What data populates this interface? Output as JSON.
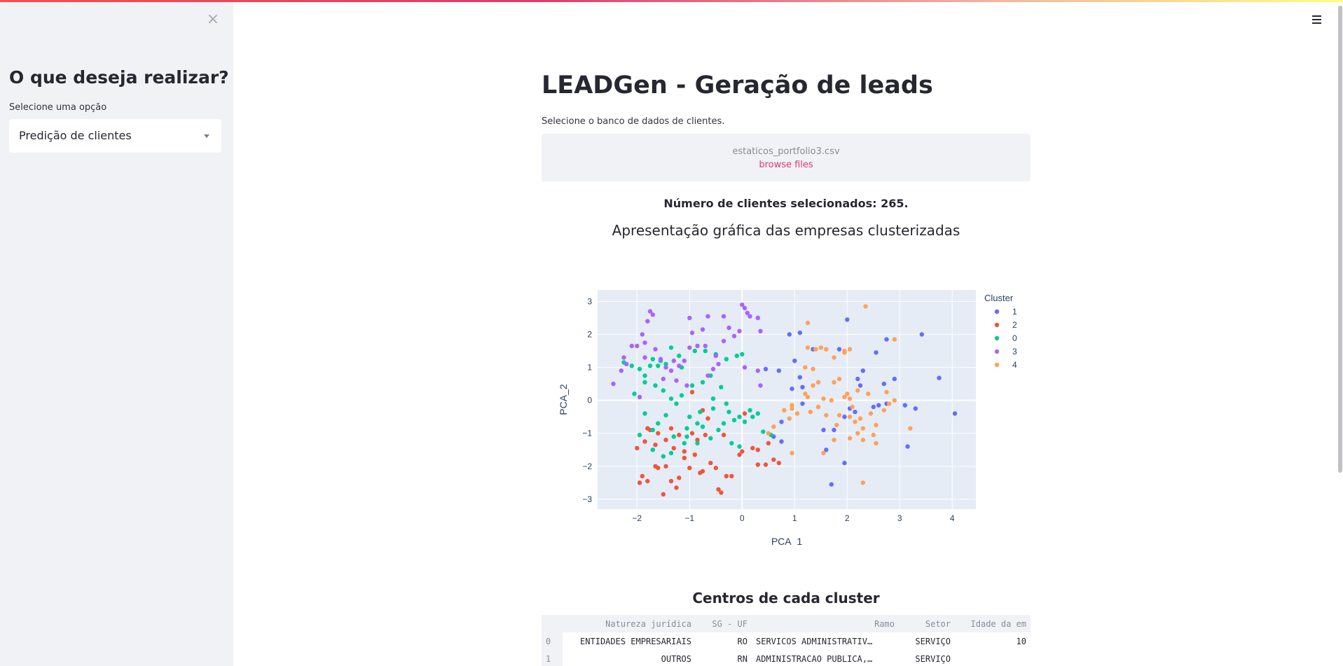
{
  "sidebar": {
    "heading": "O que deseja realizar?",
    "select_label": "Selecione uma opção",
    "selected_option": "Predição de clientes",
    "close_symbol": "×"
  },
  "main": {
    "title": "LEADGen - Geração de leads",
    "upload_label": "Selecione o banco de dados de clientes.",
    "uploaded_file": "estaticos_portfolio3.csv",
    "browse_label": "browse files",
    "count_text": "Número de clientes selecionados: 265.",
    "chart_heading": "Apresentação gráfica das empresas clusterizadas",
    "table_heading": "Centros de cada cluster"
  },
  "table": {
    "columns": [
      "",
      "Natureza jurídica",
      "SG - UF",
      "Ramo",
      "Setor",
      "Idade da em"
    ],
    "rows": [
      [
        "0",
        "ENTIDADES EMPRESARIAIS",
        "RO",
        "SERVICOS ADMINISTRATIV…",
        "SERVIÇO",
        "10"
      ],
      [
        "1",
        "OUTROS",
        "RN",
        "ADMINISTRACAO PUBLICA,…",
        "SERVIÇO",
        ""
      ]
    ]
  },
  "icons": {
    "close": "close-icon",
    "menu": "hamburger-menu-icon",
    "dropdown": "chevron-down-icon"
  },
  "chart_data": {
    "type": "scatter",
    "title": "",
    "xlabel": "PCA_1",
    "ylabel": "PCA_2",
    "xlim": [
      -2.75,
      4.45
    ],
    "ylim": [
      -3.3,
      3.35
    ],
    "xticks": [
      -2,
      -1,
      0,
      1,
      2,
      3,
      4
    ],
    "yticks": [
      -3,
      -2,
      -1,
      0,
      1,
      2,
      3
    ],
    "xtick_labels": [
      "−2",
      "−1",
      "0",
      "1",
      "2",
      "3",
      "4"
    ],
    "ytick_labels": [
      "−3",
      "−2",
      "−1",
      "0",
      "1",
      "2",
      "3"
    ],
    "legend_title": "Cluster",
    "legend_position": "right",
    "grid": true,
    "plot_bg": "#e5ecf6",
    "series": [
      {
        "name": "1",
        "color": "#636efa",
        "points": [
          [
            3.42,
            2.0
          ],
          [
            3.75,
            0.68
          ],
          [
            4.05,
            -0.4
          ],
          [
            2.0,
            2.45
          ],
          [
            1.1,
            2.05
          ],
          [
            1.35,
            1.55
          ],
          [
            2.55,
            1.45
          ],
          [
            2.75,
            1.85
          ],
          [
            0.9,
            2.0
          ],
          [
            0.7,
            0.9
          ],
          [
            1.1,
            0.7
          ],
          [
            1.15,
            0.4
          ],
          [
            0.95,
            0.35
          ],
          [
            2.2,
            0.65
          ],
          [
            2.25,
            0.45
          ],
          [
            2.9,
            0.65
          ],
          [
            2.7,
            0.5
          ],
          [
            2.5,
            -0.2
          ],
          [
            2.6,
            -0.15
          ],
          [
            2.75,
            -0.1
          ],
          [
            3.1,
            -0.15
          ],
          [
            3.3,
            -0.25
          ],
          [
            2.05,
            -0.25
          ],
          [
            2.15,
            -0.35
          ],
          [
            1.95,
            -0.5
          ],
          [
            1.75,
            -0.9
          ],
          [
            1.55,
            -0.9
          ],
          [
            0.75,
            -0.65
          ],
          [
            0.6,
            -1.1
          ],
          [
            0.75,
            -1.25
          ],
          [
            1.6,
            -1.5
          ],
          [
            3.15,
            -1.4
          ],
          [
            1.95,
            -1.9
          ],
          [
            1.7,
            -2.55
          ],
          [
            1.15,
            -0.1
          ],
          [
            0.45,
            0.95
          ],
          [
            1.0,
            1.2
          ],
          [
            1.85,
            1.55
          ],
          [
            2.3,
            0.9
          ]
        ]
      },
      {
        "name": "2",
        "color": "#ef553b",
        "points": [
          [
            -2.0,
            -1.45
          ],
          [
            -1.85,
            -1.25
          ],
          [
            -1.8,
            -0.85
          ],
          [
            -1.75,
            -0.9
          ],
          [
            -1.6,
            -1.0
          ],
          [
            -1.45,
            -1.2
          ],
          [
            -1.35,
            -0.85
          ],
          [
            -1.2,
            -1.05
          ],
          [
            -1.3,
            -1.45
          ],
          [
            -1.1,
            -1.55
          ],
          [
            -0.95,
            -1.0
          ],
          [
            -0.85,
            -1.2
          ],
          [
            -0.7,
            -1.05
          ],
          [
            -0.75,
            -0.3
          ],
          [
            -0.95,
            0.25
          ],
          [
            -0.65,
            -0.55
          ],
          [
            -1.9,
            -2.3
          ],
          [
            -1.95,
            -2.5
          ],
          [
            -1.8,
            -2.45
          ],
          [
            -1.65,
            -2.0
          ],
          [
            -1.6,
            -2.05
          ],
          [
            -1.5,
            -2.85
          ],
          [
            -1.45,
            -2.0
          ],
          [
            -1.35,
            -2.45
          ],
          [
            -1.25,
            -2.65
          ],
          [
            -1.2,
            -2.35
          ],
          [
            -1.0,
            -2.05
          ],
          [
            -0.8,
            -2.2
          ],
          [
            -0.75,
            -2.15
          ],
          [
            -0.6,
            -1.9
          ],
          [
            -0.5,
            -2.05
          ],
          [
            -0.45,
            -2.7
          ],
          [
            -0.4,
            -2.8
          ],
          [
            -0.3,
            -2.3
          ],
          [
            -0.2,
            -2.3
          ],
          [
            -0.05,
            -1.65
          ],
          [
            0.0,
            -1.55
          ],
          [
            -0.35,
            -1.05
          ],
          [
            0.05,
            -0.4
          ],
          [
            0.3,
            -1.5
          ],
          [
            0.2,
            -1.45
          ],
          [
            0.6,
            -1.8
          ],
          [
            0.5,
            -1.3
          ],
          [
            0.3,
            -1.95
          ],
          [
            0.45,
            -1.95
          ],
          [
            0.7,
            -1.9
          ],
          [
            -1.1,
            -1.75
          ],
          [
            -0.9,
            -1.65
          ],
          [
            -1.65,
            -1.35
          ]
        ]
      },
      {
        "name": "0",
        "color": "#00cc96",
        "points": [
          [
            -2.25,
            1.15
          ],
          [
            -2.1,
            1.05
          ],
          [
            -1.95,
            0.95
          ],
          [
            -1.85,
            0.75
          ],
          [
            -1.75,
            1.05
          ],
          [
            -1.7,
            1.25
          ],
          [
            -1.6,
            1.05
          ],
          [
            -1.55,
            1.2
          ],
          [
            -1.45,
            1.1
          ],
          [
            -1.35,
            1.6
          ],
          [
            -1.2,
            1.35
          ],
          [
            -1.15,
            1.0
          ],
          [
            -0.9,
            1.5
          ],
          [
            -0.7,
            1.5
          ],
          [
            -0.5,
            1.4
          ],
          [
            -0.3,
            1.25
          ],
          [
            -0.1,
            1.35
          ],
          [
            0.0,
            1.4
          ],
          [
            -1.85,
            0.55
          ],
          [
            -1.65,
            0.45
          ],
          [
            -1.5,
            0.3
          ],
          [
            -1.35,
            0.05
          ],
          [
            -1.25,
            -0.1
          ],
          [
            -1.15,
            0.15
          ],
          [
            -1.45,
            -0.45
          ],
          [
            -1.6,
            -0.7
          ],
          [
            -1.7,
            -0.9
          ],
          [
            -1.3,
            -1.1
          ],
          [
            -1.1,
            -1.3
          ],
          [
            -1.0,
            -0.5
          ],
          [
            -0.85,
            -0.7
          ],
          [
            -0.75,
            -0.8
          ],
          [
            -0.55,
            -0.25
          ],
          [
            -0.45,
            -0.9
          ],
          [
            -0.35,
            -0.7
          ],
          [
            -0.25,
            -0.35
          ],
          [
            -0.15,
            -0.6
          ],
          [
            -0.05,
            -0.5
          ],
          [
            0.05,
            -0.65
          ],
          [
            0.15,
            -0.3
          ],
          [
            0.3,
            -0.4
          ],
          [
            -0.2,
            -1.3
          ],
          [
            -0.05,
            -1.4
          ],
          [
            -0.6,
            -1.15
          ],
          [
            -0.85,
            -1.3
          ],
          [
            -1.05,
            -1.1
          ],
          [
            -1.35,
            -1.6
          ],
          [
            -1.5,
            -1.7
          ],
          [
            -1.7,
            -1.5
          ],
          [
            -1.95,
            -1.05
          ],
          [
            -2.05,
            0.2
          ],
          [
            -1.85,
            -0.4
          ],
          [
            -0.95,
            0.45
          ],
          [
            -0.75,
            0.55
          ],
          [
            -0.6,
            0.75
          ],
          [
            -0.4,
            0.4
          ],
          [
            -0.55,
            0.05
          ],
          [
            -0.3,
            -0.1
          ],
          [
            0.2,
            -0.5
          ],
          [
            0.4,
            -0.95
          ],
          [
            0.55,
            -1.05
          ],
          [
            -1.05,
            -0.85
          ],
          [
            -0.8,
            -0.35
          ]
        ]
      },
      {
        "name": "3",
        "color": "#ab63fa",
        "points": [
          [
            -2.45,
            0.5
          ],
          [
            -2.3,
            0.9
          ],
          [
            -2.2,
            1.1
          ],
          [
            -2.1,
            1.65
          ],
          [
            -2.0,
            1.65
          ],
          [
            -1.9,
            2.0
          ],
          [
            -1.85,
            1.75
          ],
          [
            -1.95,
            0.1
          ],
          [
            -1.8,
            2.4
          ],
          [
            -1.75,
            2.7
          ],
          [
            -1.7,
            2.6
          ],
          [
            -1.65,
            1.55
          ],
          [
            -1.55,
            1.25
          ],
          [
            -1.45,
            1.0
          ],
          [
            -1.35,
            0.9
          ],
          [
            -1.3,
            1.2
          ],
          [
            -1.2,
            1.05
          ],
          [
            -1.1,
            1.2
          ],
          [
            -1.0,
            1.6
          ],
          [
            -0.95,
            2.05
          ],
          [
            -0.85,
            1.65
          ],
          [
            -0.75,
            2.15
          ],
          [
            -0.7,
            1.65
          ],
          [
            -0.65,
            2.55
          ],
          [
            -0.5,
            1.35
          ],
          [
            -0.45,
            1.1
          ],
          [
            -0.35,
            2.55
          ],
          [
            -0.25,
            2.2
          ],
          [
            -0.15,
            1.95
          ],
          [
            -0.05,
            2.1
          ],
          [
            0.0,
            2.9
          ],
          [
            0.05,
            2.8
          ],
          [
            0.1,
            2.65
          ],
          [
            0.15,
            2.55
          ],
          [
            0.3,
            2.5
          ],
          [
            0.35,
            2.1
          ],
          [
            0.35,
            0.45
          ],
          [
            -0.55,
            0.95
          ],
          [
            -0.65,
            0.75
          ],
          [
            -1.05,
            0.45
          ],
          [
            -1.5,
            0.65
          ],
          [
            -1.25,
            0.6
          ],
          [
            -1.85,
            1.3
          ],
          [
            -2.25,
            1.3
          ],
          [
            -0.35,
            1.8
          ],
          [
            -1.0,
            2.5
          ],
          [
            0.05,
            1.0
          ],
          [
            0.3,
            0.9
          ]
        ]
      },
      {
        "name": "4",
        "color": "#ffa15a",
        "points": [
          [
            2.35,
            2.85
          ],
          [
            2.9,
            1.85
          ],
          [
            1.25,
            2.35
          ],
          [
            1.25,
            1.6
          ],
          [
            1.4,
            1.55
          ],
          [
            1.5,
            1.6
          ],
          [
            1.6,
            1.55
          ],
          [
            1.75,
            1.3
          ],
          [
            1.95,
            1.5
          ],
          [
            2.05,
            1.55
          ],
          [
            1.95,
            1.45
          ],
          [
            1.2,
            1.0
          ],
          [
            1.35,
            0.95
          ],
          [
            1.45,
            0.55
          ],
          [
            1.75,
            0.55
          ],
          [
            1.85,
            0.65
          ],
          [
            1.55,
            0.05
          ],
          [
            1.7,
            0.0
          ],
          [
            1.45,
            -0.2
          ],
          [
            1.3,
            -0.35
          ],
          [
            1.05,
            -0.4
          ],
          [
            0.95,
            -0.25
          ],
          [
            0.8,
            -0.3
          ],
          [
            0.95,
            -0.15
          ],
          [
            1.2,
            0.2
          ],
          [
            1.6,
            -0.45
          ],
          [
            1.85,
            -0.45
          ],
          [
            2.05,
            -0.5
          ],
          [
            2.15,
            -0.65
          ],
          [
            2.3,
            -0.85
          ],
          [
            2.45,
            -0.4
          ],
          [
            2.55,
            -0.75
          ],
          [
            2.7,
            -0.3
          ],
          [
            2.5,
            -1.05
          ],
          [
            2.55,
            -1.3
          ],
          [
            2.3,
            -1.2
          ],
          [
            2.2,
            -1.0
          ],
          [
            1.95,
            0.1
          ],
          [
            2.0,
            0.2
          ],
          [
            2.2,
            0.3
          ],
          [
            2.4,
            0.2
          ],
          [
            2.75,
            0.25
          ],
          [
            2.9,
            0.0
          ],
          [
            3.2,
            -0.85
          ],
          [
            0.6,
            -0.8
          ],
          [
            0.9,
            -0.55
          ],
          [
            0.5,
            -1.0
          ],
          [
            0.95,
            -1.6
          ],
          [
            1.55,
            -1.6
          ],
          [
            2.3,
            -2.5
          ],
          [
            2.05,
            -1.15
          ],
          [
            1.75,
            -1.2
          ],
          [
            2.8,
            -0.1
          ],
          [
            2.1,
            -0.2
          ],
          [
            2.25,
            -0.55
          ],
          [
            2.05,
            0.05
          ],
          [
            1.8,
            -0.75
          ],
          [
            1.35,
            0.45
          ],
          [
            1.25,
            0.1
          ]
        ]
      }
    ]
  }
}
